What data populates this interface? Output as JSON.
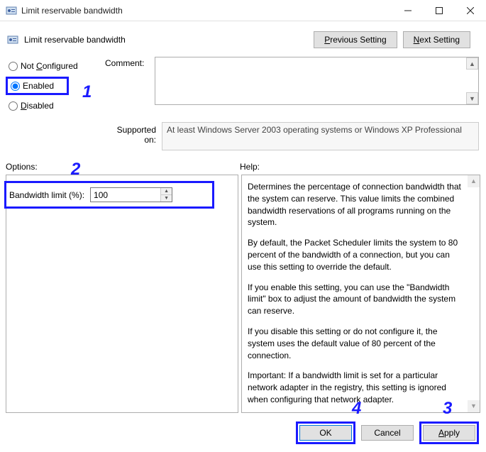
{
  "window": {
    "title": "Limit reservable bandwidth"
  },
  "header": {
    "title": "Limit reservable bandwidth",
    "prev_btn": "Previous Setting",
    "next_btn": "Next Setting"
  },
  "state_options": {
    "not_configured": "Not Configured",
    "enabled": "Enabled",
    "disabled": "Disabled",
    "selected": "enabled"
  },
  "comment": {
    "label": "Comment:",
    "value": ""
  },
  "supported": {
    "label": "Supported on:",
    "text": "At least Windows Server 2003 operating systems or Windows XP Professional"
  },
  "sections": {
    "options": "Options:",
    "help": "Help:"
  },
  "bandwidth": {
    "label": "Bandwidth limit (%):",
    "value": "100"
  },
  "help_text": {
    "p1": "Determines the percentage of connection bandwidth that the system can reserve. This value limits the combined bandwidth reservations of all programs running on the system.",
    "p2": "By default, the Packet Scheduler limits the system to 80 percent of the bandwidth of a connection, but you can use this setting to override the default.",
    "p3": "If you enable this setting, you can use the \"Bandwidth limit\" box to adjust the amount of bandwidth the system can reserve.",
    "p4": "If you disable this setting or do not configure it, the system uses the default value of 80 percent of the connection.",
    "p5": "Important: If a bandwidth limit is set for a particular network adapter in the registry, this setting is ignored when configuring that network adapter."
  },
  "footer": {
    "ok": "OK",
    "cancel": "Cancel",
    "apply": "Apply"
  },
  "annotations": {
    "a1": "1",
    "a2": "2",
    "a3": "3",
    "a4": "4"
  }
}
